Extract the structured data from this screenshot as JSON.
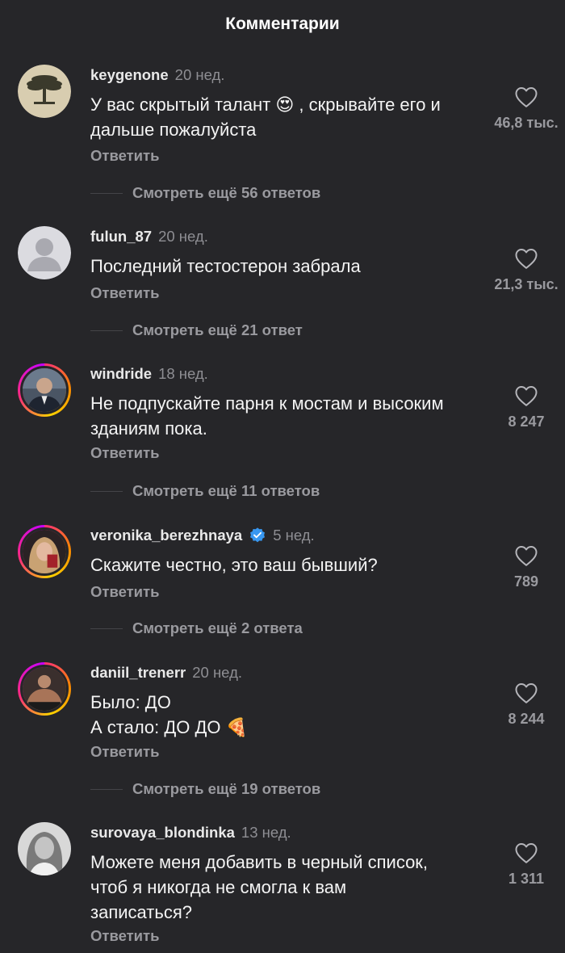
{
  "header": {
    "title": "Комментарии"
  },
  "icons": {
    "like": "heart-outline-icon",
    "verified": "verified-badge-icon"
  },
  "comments": [
    {
      "username": "keygenone",
      "time": "20 нед.",
      "lines": [
        "У вас скрытый талант",
        ", скрывайте его и",
        "дальше пожалуйста"
      ],
      "emoji": "😍",
      "likes": "46,8 тыс.",
      "reply_label": "Ответить",
      "more_replies": "Смотреть ещё 56 ответов",
      "avatar": "tree-avatar"
    },
    {
      "username": "fulun_87",
      "time": "20 нед.",
      "lines": [
        "Последний тестостерон забрала"
      ],
      "likes": "21,3 тыс.",
      "reply_label": "Ответить",
      "more_replies": "Смотреть ещё 21 ответ",
      "avatar": "default-avatar"
    },
    {
      "username": "windride",
      "time": "18 нед.",
      "lines": [
        "Не подпускайте парня к мостам и высоким",
        "зданиям пока."
      ],
      "likes": "8 247",
      "reply_label": "Ответить",
      "more_replies": "Смотреть ещё 11 ответов",
      "avatar": "man-avatar"
    },
    {
      "username": "veronika_berezhnaya",
      "verified": true,
      "time": "5 нед.",
      "lines": [
        "Скажите честно, это ваш бывший?"
      ],
      "likes": "789",
      "reply_label": "Ответить",
      "more_replies": "Смотреть ещё 2 ответа",
      "avatar": "woman-avatar"
    },
    {
      "username": "daniil_trenerr",
      "time": "20 нед.",
      "lines": [
        "Было: ДО",
        "А стало: ДО ДО"
      ],
      "emoji": "🍕",
      "likes": "8 244",
      "reply_label": "Ответить",
      "more_replies": "Смотреть ещё 19 ответов",
      "avatar": "athlete-avatar"
    },
    {
      "username": "surovaya_blondinka",
      "time": "13 нед.",
      "lines": [
        "Можете меня добавить в черный список,",
        "чтоб я никогда не смогла к вам",
        "записаться?"
      ],
      "likes": "1 311",
      "reply_label": "Ответить",
      "avatar": "portrait-avatar"
    }
  ]
}
